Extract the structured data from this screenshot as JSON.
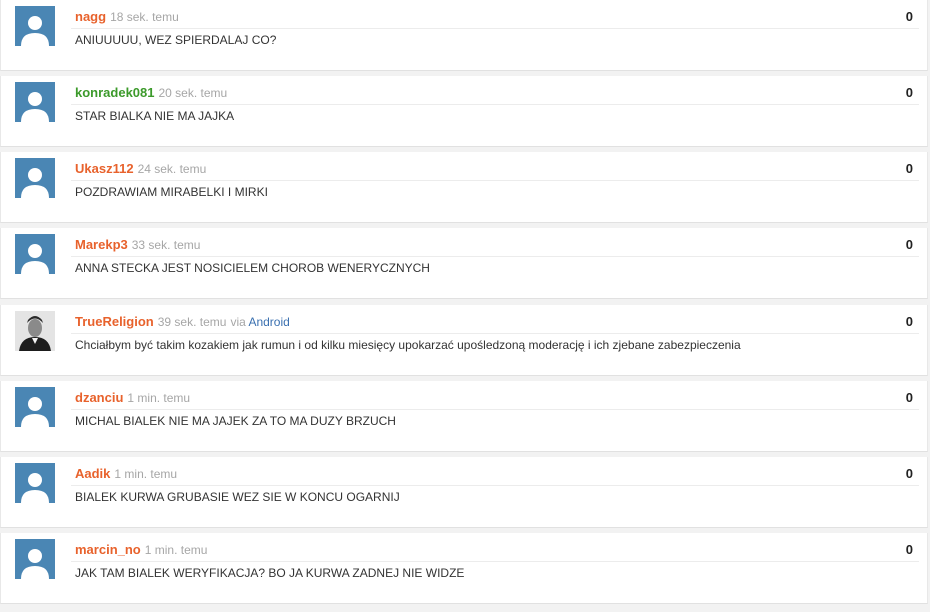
{
  "colors": {
    "orange_author": "#e8622c",
    "green_author": "#3c9a2b",
    "avatar_bg": "#4a86b4",
    "platform_link": "#3a70b0"
  },
  "entries": [
    {
      "author": "nagg",
      "author_color": "#e8622c",
      "time": "18 sek. temu",
      "via": "",
      "platform": "",
      "text": "ANIUUUUU, WEZ SPIERDALAJ CO?",
      "score": "0",
      "avatar": "default-avatar"
    },
    {
      "author": "konradek081",
      "author_color": "#3c9a2b",
      "time": "20 sek. temu",
      "via": "",
      "platform": "",
      "text": "STAR BIALKA NIE MA JAJKA",
      "score": "0",
      "avatar": "default-avatar"
    },
    {
      "author": "Ukasz112",
      "author_color": "#e8622c",
      "time": "24 sek. temu",
      "via": "",
      "platform": "",
      "text": "POZDRAWIAM MIRABELKI I MIRKI",
      "score": "0",
      "avatar": "default-avatar"
    },
    {
      "author": "Marekp3",
      "author_color": "#e8622c",
      "time": "33 sek. temu",
      "via": "",
      "platform": "",
      "text": "ANNA STECKA JEST NOSICIELEM CHOROB WENERYCZNYCH",
      "score": "0",
      "avatar": "default-avatar"
    },
    {
      "author": "TrueReligion",
      "author_color": "#e8622c",
      "time": "39 sek. temu",
      "via": "via",
      "platform": "Android",
      "text": "Chciałbym być takim kozakiem jak rumun i od kilku miesięcy upokarzać upośledzoną moderację i ich zjebane zabezpieczenia",
      "score": "0",
      "avatar": "photo-avatar"
    },
    {
      "author": "dzanciu",
      "author_color": "#e8622c",
      "time": "1 min. temu",
      "via": "",
      "platform": "",
      "text": "MICHAL BIALEK NIE MA JAJEK ZA TO MA DUZY BRZUCH",
      "score": "0",
      "avatar": "default-avatar"
    },
    {
      "author": "Aadik",
      "author_color": "#e8622c",
      "time": "1 min. temu",
      "via": "",
      "platform": "",
      "text": "BIALEK KURWA GRUBASIE WEZ SIE W KONCU OGARNIJ",
      "score": "0",
      "avatar": "default-avatar"
    },
    {
      "author": "marcin_no",
      "author_color": "#e8622c",
      "time": "1 min. temu",
      "via": "",
      "platform": "",
      "text": "JAK TAM BIALEK WERYFIKACJA? BO JA KURWA ZADNEJ NIE WIDZE",
      "score": "0",
      "avatar": "default-avatar"
    }
  ]
}
